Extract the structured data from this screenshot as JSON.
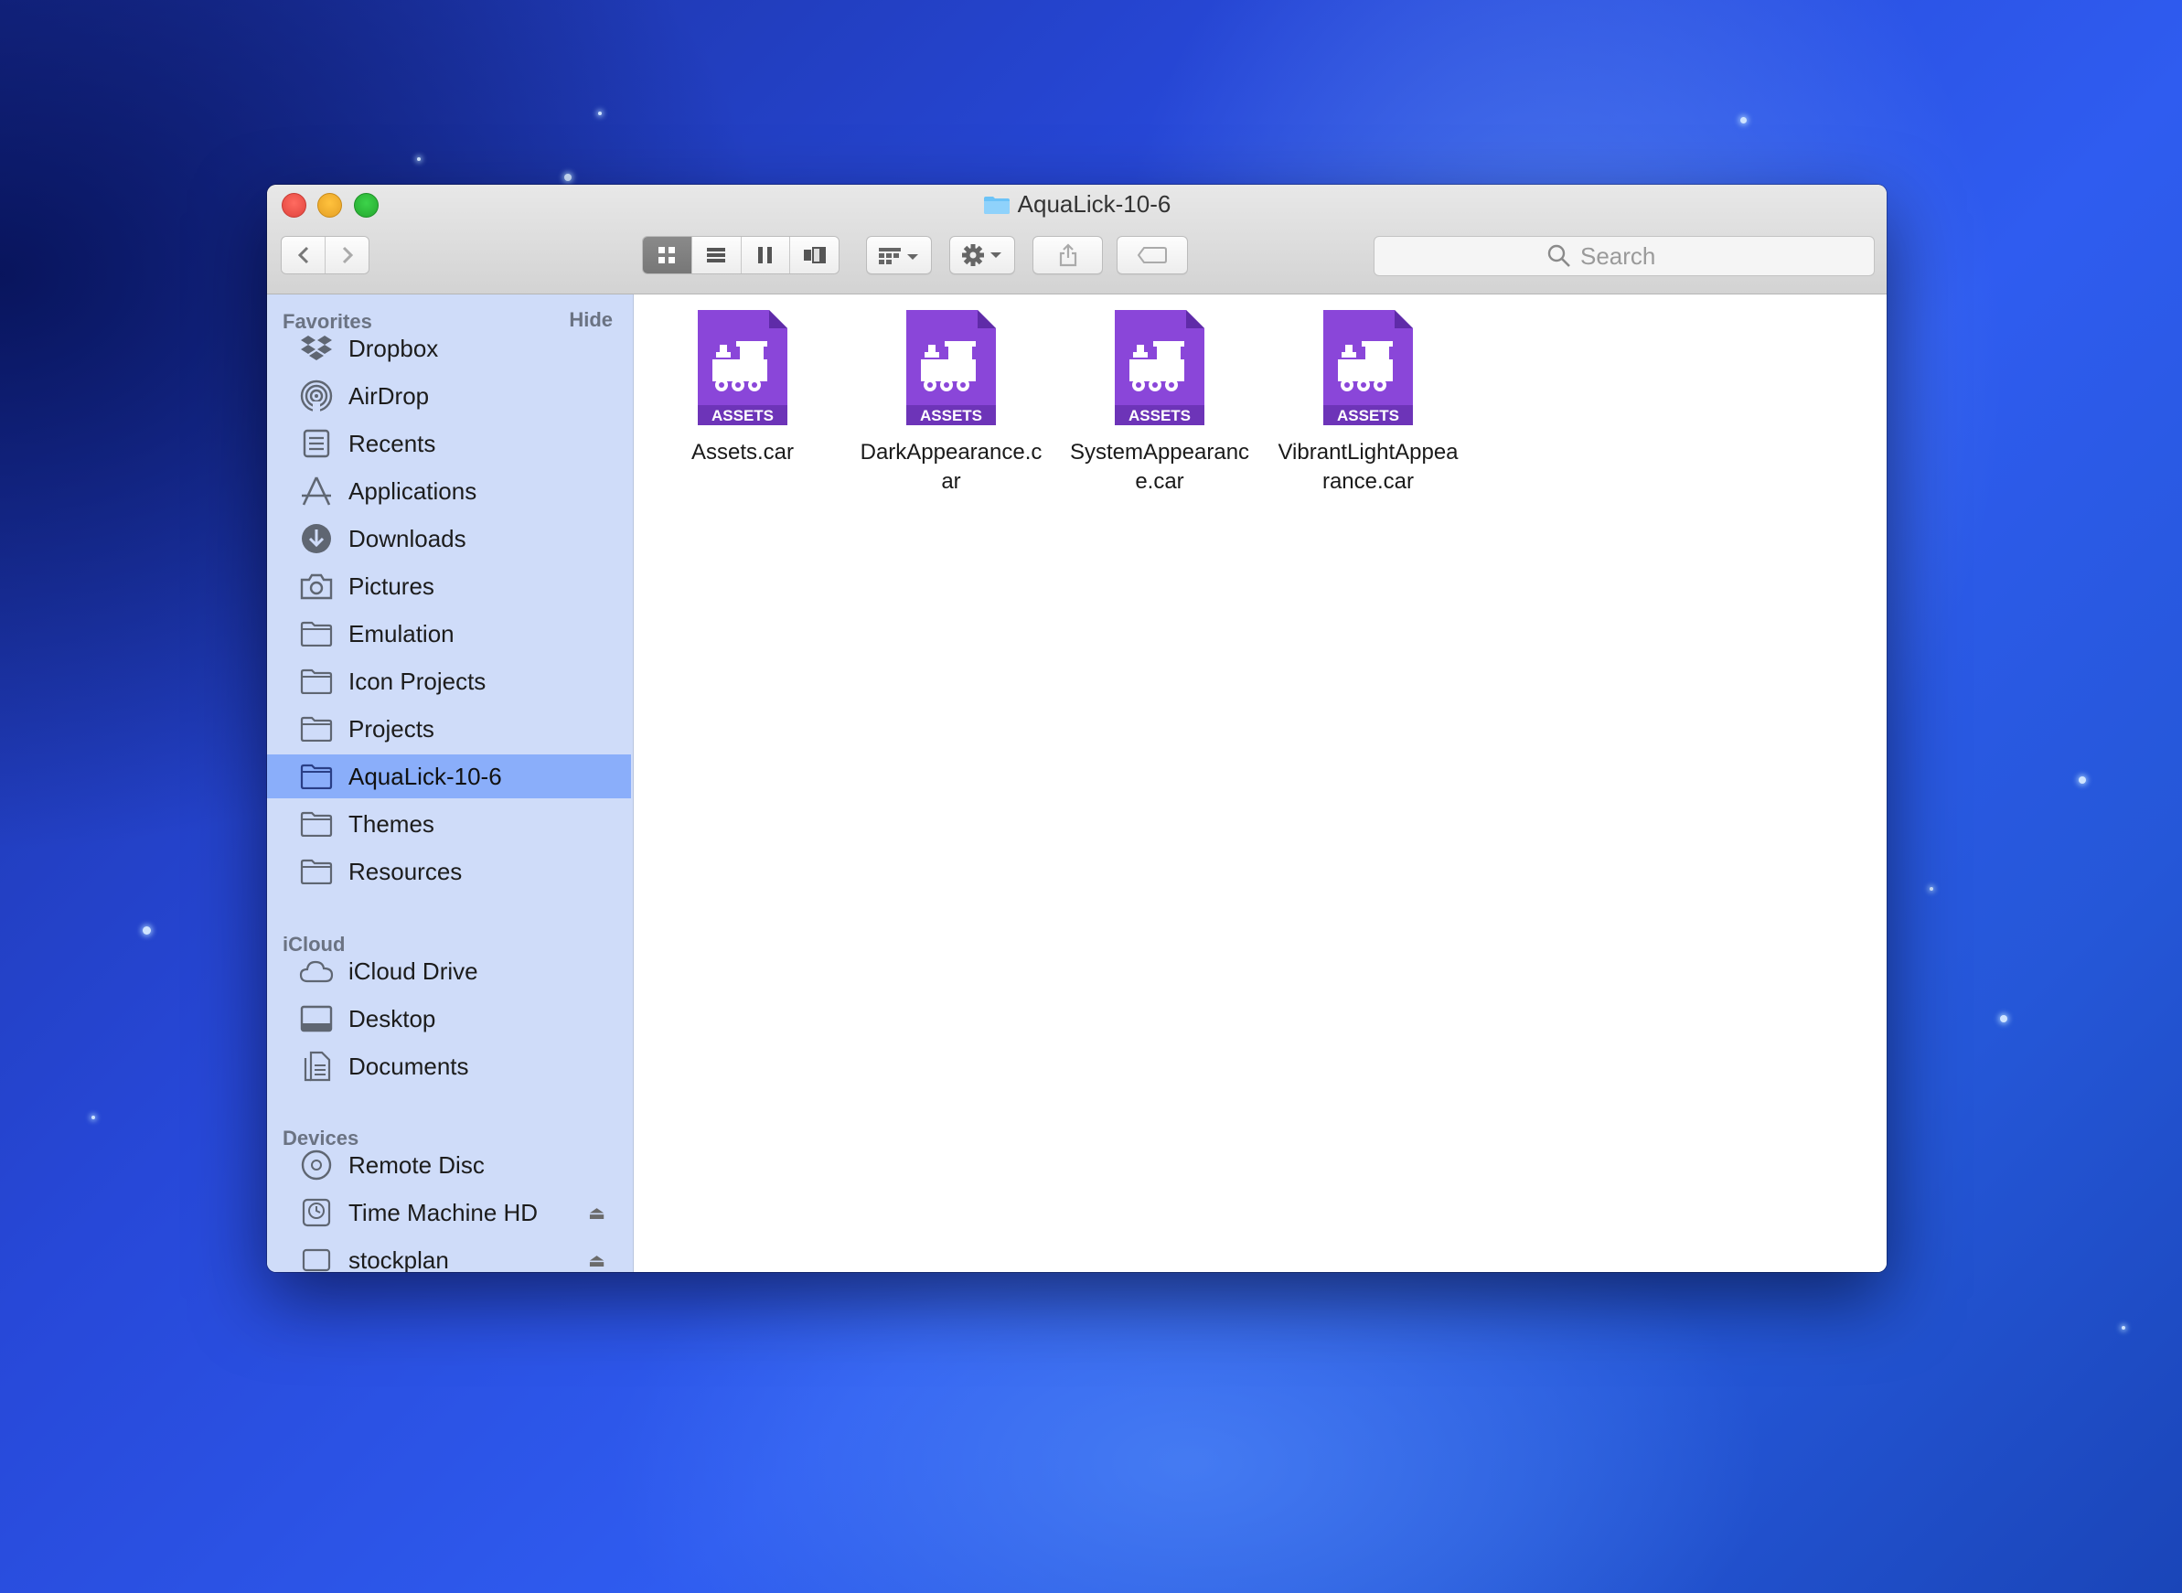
{
  "window": {
    "title": "AquaLick-10-6"
  },
  "toolbar": {
    "back_label": "◀",
    "forward_label": "▶",
    "view_modes": [
      "icon",
      "list",
      "columns",
      "cover-flow"
    ],
    "active_view": "icon",
    "search_placeholder": "Search"
  },
  "sidebar": {
    "favorites_header": "Favorites",
    "hide_label": "Hide",
    "favorites": [
      {
        "label": "Dropbox",
        "icon": "dropbox-icon"
      },
      {
        "label": "AirDrop",
        "icon": "airdrop-icon"
      },
      {
        "label": "Recents",
        "icon": "recents-icon"
      },
      {
        "label": "Applications",
        "icon": "applications-icon"
      },
      {
        "label": "Downloads",
        "icon": "downloads-icon"
      },
      {
        "label": "Pictures",
        "icon": "camera-icon"
      },
      {
        "label": "Emulation",
        "icon": "folder-icon"
      },
      {
        "label": "Icon Projects",
        "icon": "folder-icon"
      },
      {
        "label": "Projects",
        "icon": "folder-icon"
      },
      {
        "label": "AquaLick-10-6",
        "icon": "folder-icon",
        "selected": true
      },
      {
        "label": "Themes",
        "icon": "folder-icon"
      },
      {
        "label": "Resources",
        "icon": "folder-icon"
      }
    ],
    "icloud_header": "iCloud",
    "icloud": [
      {
        "label": "iCloud Drive",
        "icon": "cloud-icon"
      },
      {
        "label": "Desktop",
        "icon": "desktop-icon"
      },
      {
        "label": "Documents",
        "icon": "documents-icon"
      }
    ],
    "devices_header": "Devices",
    "devices": [
      {
        "label": "Remote Disc",
        "icon": "disc-icon"
      },
      {
        "label": "Time Machine HD",
        "icon": "time-machine-icon",
        "eject": "⏏"
      },
      {
        "label": "stockplan",
        "icon": "drive-icon",
        "eject": "⏏"
      }
    ]
  },
  "files": [
    {
      "name": "Assets.car",
      "badge": "ASSETS"
    },
    {
      "name": "DarkAppearance.c\nar",
      "badge": "ASSETS"
    },
    {
      "name": "SystemAppearanc\ne.car",
      "badge": "ASSETS"
    },
    {
      "name": "VibrantLightAppea\nrance.car",
      "badge": "ASSETS"
    }
  ],
  "colors": {
    "asset_purple": "#8a46d9",
    "sidebar_bg": "#cfdcf9",
    "sidebar_selected": "#8aaefa"
  }
}
